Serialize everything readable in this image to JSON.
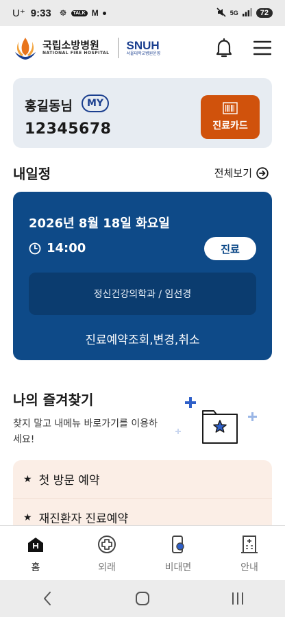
{
  "status_bar": {
    "carrier": "U⁺",
    "time": "9:33",
    "notifications": [
      "☸",
      "TALK",
      "M"
    ],
    "battery": "72",
    "signal": "5G"
  },
  "header": {
    "logo_kr": "국립소방병원",
    "logo_en": "NATIONAL FIRE HOSPITAL",
    "partner_name": "SNUH",
    "partner_sub": "서울대학교병원운영",
    "bell_icon": "bell-icon",
    "menu_icon": "hamburger-menu-icon"
  },
  "profile": {
    "name": "홍길동님",
    "badge": "MY",
    "patient_number": "12345678",
    "card_button_label": "진료카드"
  },
  "schedule": {
    "title": "내일정",
    "view_all": "전체보기",
    "date": "2026년 8월 18일 화요일",
    "time": "14:00",
    "type": "진료",
    "department": "정신건강의학과 / 임선경",
    "action_link": "진료예약조회,변경,취소"
  },
  "favorites": {
    "title": "나의 즐겨찾기",
    "description": "찾지 말고 내메뉴 바로가기를 이용하세요!",
    "items": [
      {
        "label": "첫 방문 예약"
      },
      {
        "label": "재진환자 진료예약"
      }
    ]
  },
  "bottom_nav": {
    "items": [
      {
        "label": "홈",
        "icon": "home-icon"
      },
      {
        "label": "외래",
        "icon": "medical-cross-icon"
      },
      {
        "label": "비대면",
        "icon": "phone-icon"
      },
      {
        "label": "안내",
        "icon": "building-icon"
      }
    ]
  },
  "colors": {
    "brand_navy": "#0e4a88",
    "brand_orange": "#d0520c",
    "card_bg": "#e7ecf2",
    "fav_bg": "#fbeee6"
  }
}
